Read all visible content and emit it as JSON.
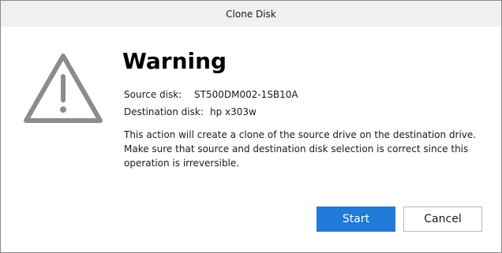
{
  "window": {
    "title": "Clone Disk"
  },
  "dialog": {
    "heading": "Warning",
    "icon": "warning-triangle-icon",
    "source": {
      "label": "Source disk:",
      "value": "ST500DM002-1SB10A"
    },
    "destination": {
      "label": "Destination disk:",
      "value": "hp x303w"
    },
    "description": "This action will create a clone of the source drive on the destination drive. Make sure that source and destination disk selection is correct since this operation is irreversible."
  },
  "buttons": {
    "start_label": "Start",
    "cancel_label": "Cancel"
  },
  "colors": {
    "accent": "#1f7ad8",
    "titlebar_bg": "#f0f0f0",
    "icon_stroke": "#8c8c8c"
  }
}
